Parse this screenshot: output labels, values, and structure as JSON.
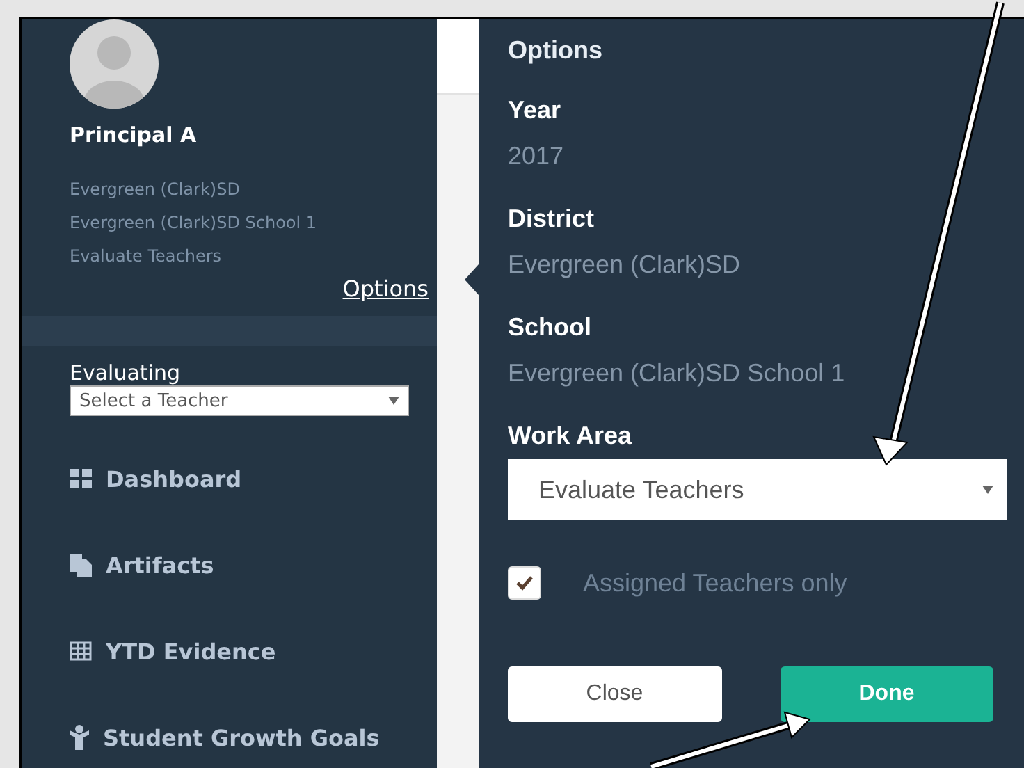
{
  "sidebar": {
    "user_name": "Principal A",
    "context_lines": [
      "Evergreen (Clark)SD",
      "Evergreen (Clark)SD School 1",
      "Evaluate Teachers"
    ],
    "options_link": "Options",
    "evaluating": {
      "label": "Evaluating",
      "value": "Select a Teacher"
    },
    "nav_items": [
      {
        "label": "Dashboard"
      },
      {
        "label": "Artifacts"
      },
      {
        "label": "YTD Evidence"
      },
      {
        "label": "Student Growth Goals"
      }
    ]
  },
  "options_popover": {
    "title": "Options",
    "fields": [
      {
        "label": "Year",
        "value": "2017"
      },
      {
        "label": "District",
        "value": "Evergreen (Clark)SD"
      },
      {
        "label": "School",
        "value": "Evergreen (Clark)SD School 1"
      }
    ],
    "work_area": {
      "label": "Work Area",
      "value": "Evaluate Teachers"
    },
    "assigned_only": {
      "label": "Assigned Teachers only",
      "checked": true
    },
    "buttons": {
      "close": "Close",
      "done": "Done"
    }
  }
}
